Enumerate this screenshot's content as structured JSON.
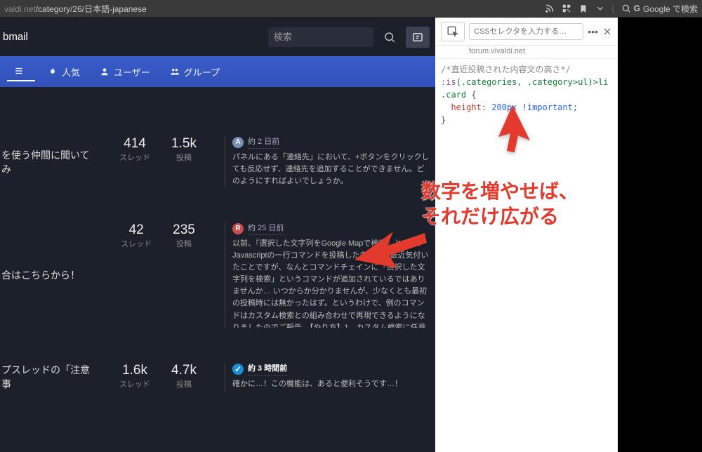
{
  "browser": {
    "url_prefix": "valdi.net",
    "url_path": "/category/26/日本語-japanese",
    "search_label": "Google で検索"
  },
  "header": {
    "brand_visible": "bmail",
    "search_placeholder": "検索"
  },
  "nav": {
    "item0": " ",
    "item1": "人気",
    "item2": "ユーザー",
    "item3": "グループ"
  },
  "rows": [
    {
      "title": "を使う仲間に聞いてみ",
      "threads_num": "414",
      "threads_lab": "スレッド",
      "posts_num": "1.5k",
      "posts_lab": "投稿",
      "avatar_letter": "A",
      "timestamp": "約 2 日前",
      "body": "パネルにある「連絡先」において、+ボタンをクリックしても反応せず、連絡先を追加することができません。どのようにすればよいでしょうか。"
    },
    {
      "title": "合はこちらから！",
      "threads_num": "42",
      "threads_lab": "スレッド",
      "posts_num": "235",
      "posts_lab": "投稿",
      "avatar_letter": "R",
      "timestamp": "約 25 日前",
      "body": "以前、『選択した文字列をGoogle Mapで検索』という、Javascriptの一行コマンドを投稿した者です。最近気付いたことですが、なんとコマンドチェインに「選択した文字列を検索」というコマンドが追加されているではありませんか… いつからか分かりませんが、少なくとも最初の投稿時には無かったはず。というわけで、例のコマンドはカスタム検索との組み合わせで再現できるようになりましたのでご報告。【やり方】1．カスタム検索に任意の検索を登録 2023-02-16_19h41_54.jpg 2. コマンドチェインを作成。「選択した文字列を検索」→「（1で追加したカスタム検索）」の1行のみ。2023-02-16_19h44_06.jpg あとはマウスジェ"
    },
    {
      "title": "プスレッドの「注意事",
      "threads_num": "1.6k",
      "threads_lab": "スレッド",
      "posts_num": "4.7k",
      "posts_lab": "投稿",
      "avatar_letter": "✓",
      "timestamp": "約 3 時間前",
      "body": "確かに…！この機能は、あると便利そうです…！"
    }
  ],
  "devtools": {
    "css_placeholder": "CSSセレクタを入力する…",
    "hostname": "forum.vivaldi.net",
    "comment": "/*直近投稿された内容文の高さ*/",
    "selector1": ":is",
    "selector2": "(.categories, .category>ul)>li .card",
    "brace_open": " {",
    "prop": "height",
    "colon": ": ",
    "val": "200px !important",
    "semi": ";",
    "brace_close": "}"
  },
  "annotation": {
    "line1": "数字を増やせば、",
    "line2": "それだけ広がる"
  }
}
